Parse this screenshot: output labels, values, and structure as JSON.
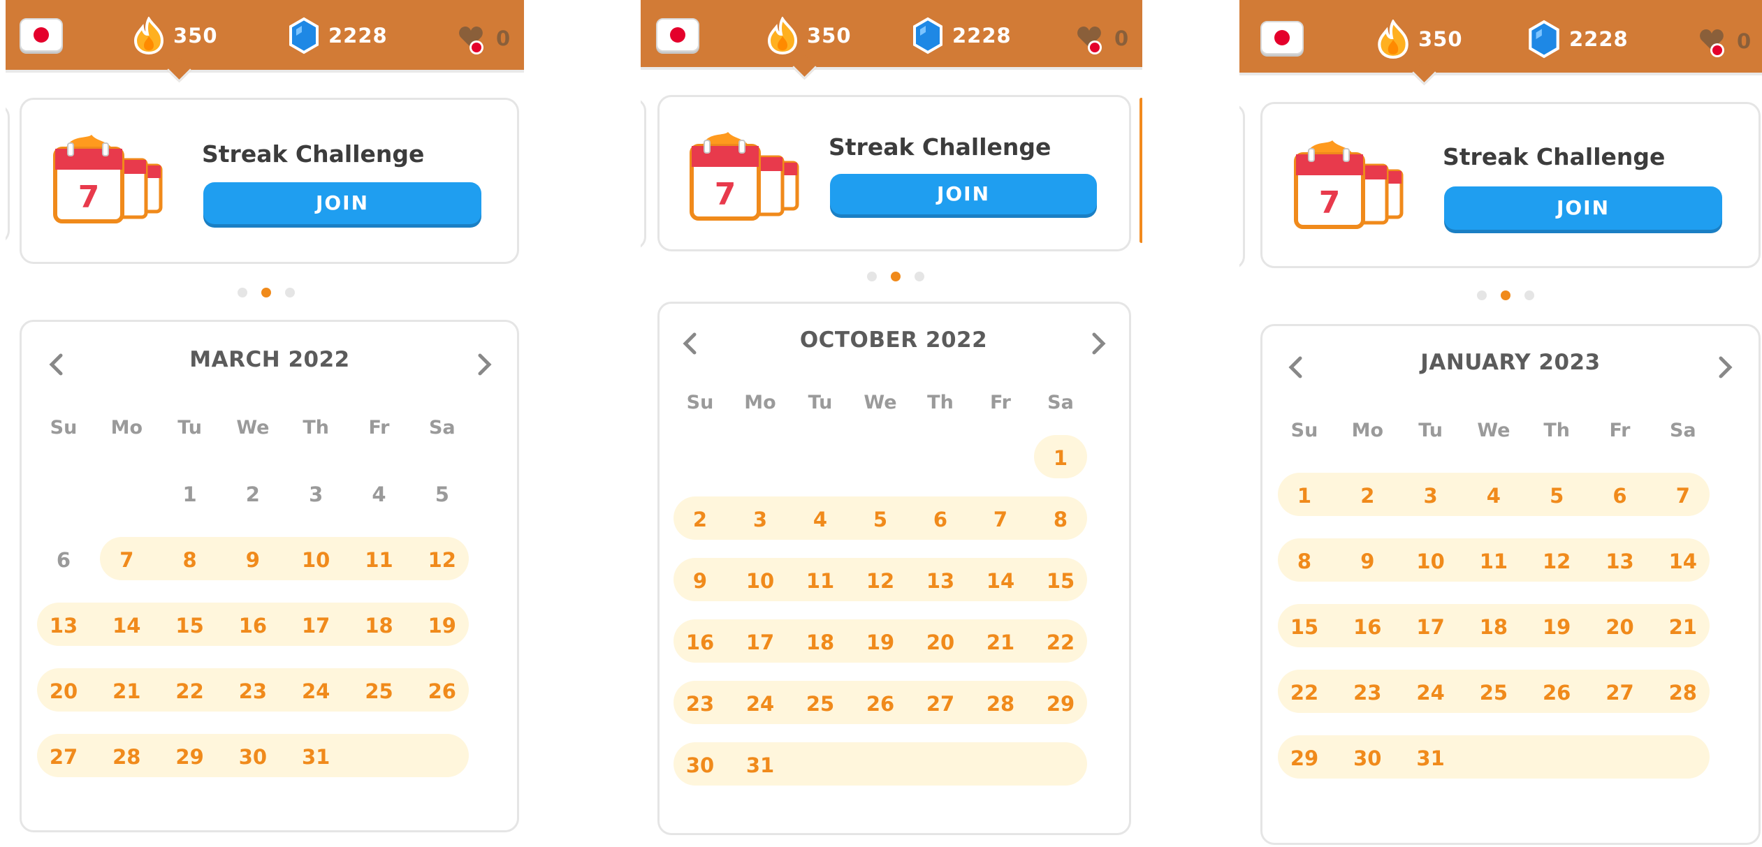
{
  "header": {
    "flag_icon": "japan-flag-icon",
    "streak_count": "350",
    "gems_count": "2228",
    "hearts_count": "0"
  },
  "challenge": {
    "title": "Streak Challenge",
    "join_label": "JOIN",
    "calendar_number": "7"
  },
  "weekdays": [
    "Su",
    "Mo",
    "Tu",
    "We",
    "Th",
    "Fr",
    "Sa"
  ],
  "calendars": [
    {
      "month": "MARCH 2022"
    },
    {
      "month": "OCTOBER 2022"
    },
    {
      "month": "JANUARY 2023"
    }
  ],
  "colors": {
    "topbar": "#d27b36",
    "streak_orange": "#f08a1b",
    "streak_band": "#fff6dc",
    "join_blue": "#1f9ef0"
  }
}
